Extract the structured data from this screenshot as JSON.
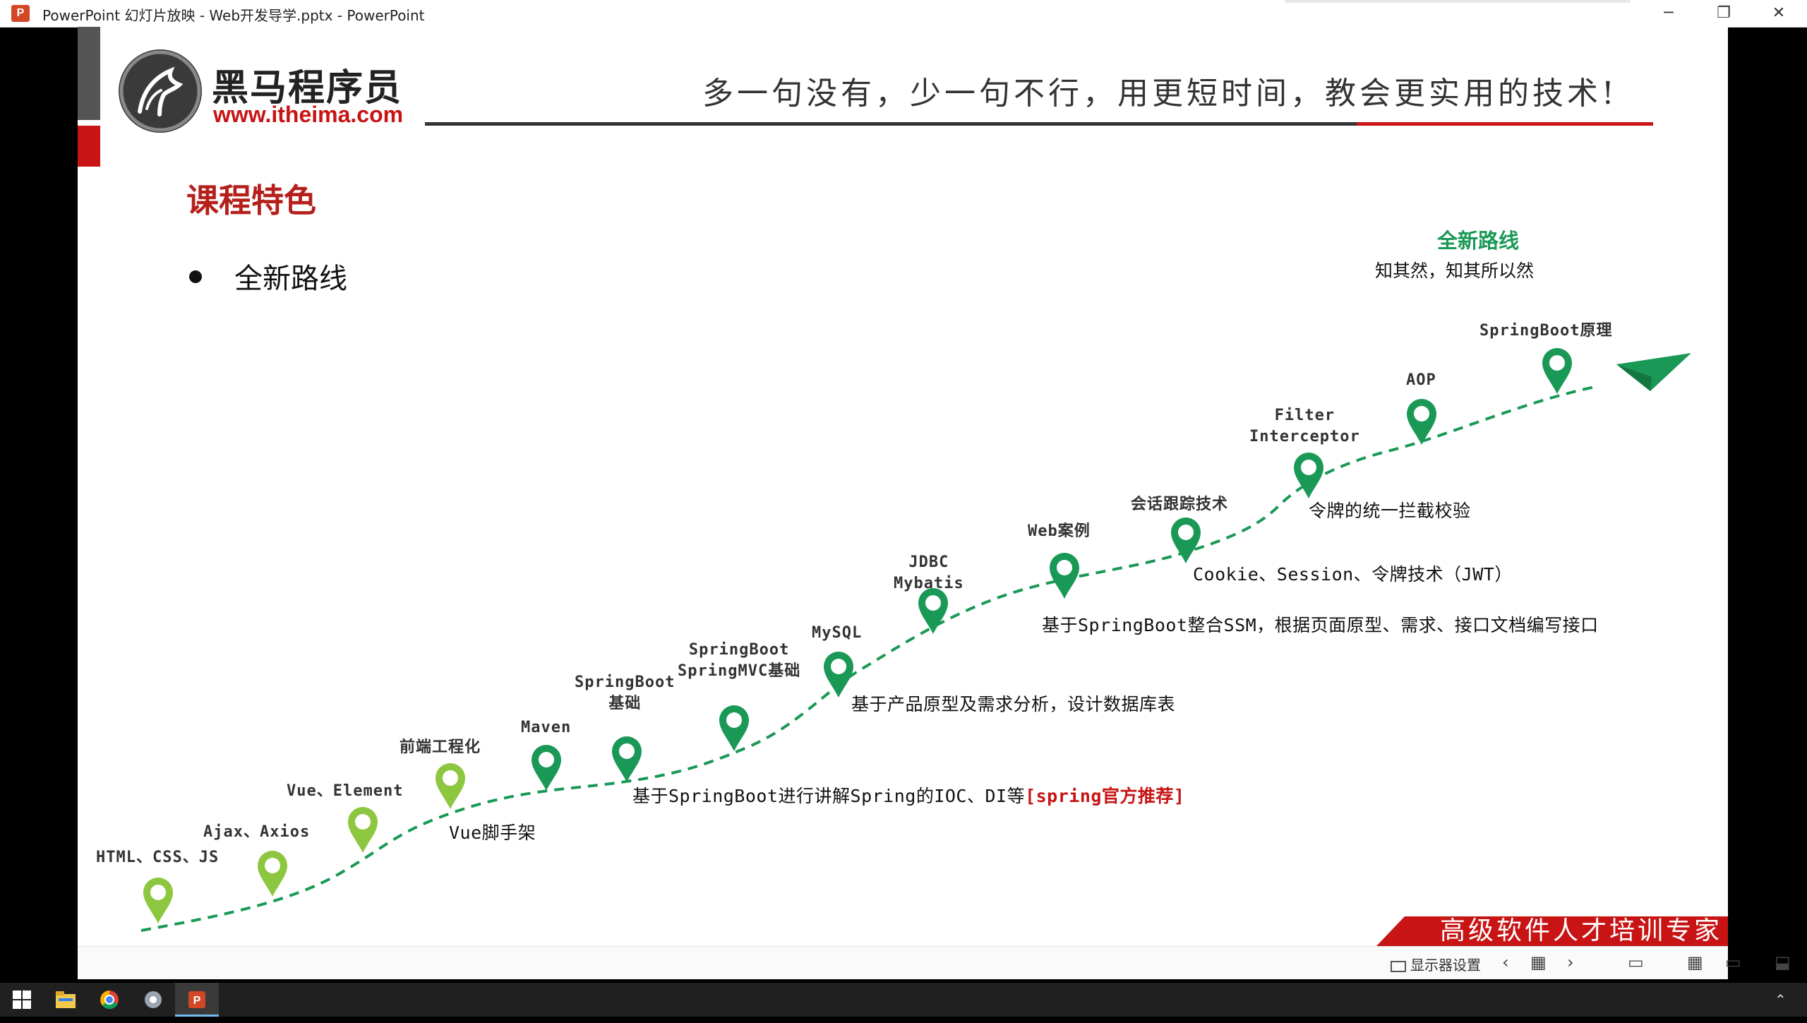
{
  "window": {
    "title": "PowerPoint 幻灯片放映  -  Web开发导学.pptx  -  PowerPoint",
    "app_icon": "P",
    "controls": {
      "minimize": "─",
      "restore": "❐",
      "close": "✕"
    }
  },
  "slide": {
    "logo": {
      "name": "黑马程序员",
      "url": "www.itheima.com"
    },
    "slogan": "多一句没有，少一句不行，用更短时间，教会更实用的技术!",
    "section_title": "课程特色",
    "bullet": "全新路线",
    "milestones": [
      {
        "label": "HTML、CSS、JS",
        "color": "#8dc63f"
      },
      {
        "label": "Ajax、Axios",
        "color": "#8dc63f"
      },
      {
        "label": "Vue、Element",
        "color": "#8dc63f"
      },
      {
        "label": "前端工程化",
        "color": "#8dc63f"
      },
      {
        "label": "Maven",
        "color": "#1a9956"
      },
      {
        "label": "SpringBoot\n基础",
        "color": "#1a9956"
      },
      {
        "label": "SpringBoot\nSpringMVC基础",
        "color": "#1a9956"
      },
      {
        "label": "MySQL",
        "color": "#1a9956"
      },
      {
        "label": "JDBC\nMybatis",
        "color": "#1a9956"
      },
      {
        "label": "Web案例",
        "color": "#1a9956"
      },
      {
        "label": "会话跟踪技术",
        "color": "#1a9956"
      },
      {
        "label": "Filter\nInterceptor",
        "color": "#1a9956"
      },
      {
        "label": "AOP",
        "color": "#1a9956"
      },
      {
        "label": "SpringBoot原理",
        "color": "#1a9956"
      }
    ],
    "descriptions": {
      "vue_scaffold": "Vue脚手架",
      "springboot_ioc": "基于SpringBoot进行讲解Spring的IOC、DI等",
      "springboot_ioc_highlight": "[spring官方推荐]",
      "db_design": "基于产品原型及需求分析，设计数据库表",
      "ssm_api": "基于SpringBoot整合SSM，根据页面原型、需求、接口文档编写接口",
      "session": "Cookie、Session、令牌技术（JWT）",
      "token_check": "令牌的统一拦截校验",
      "principle": "知其然，知其所以然"
    },
    "route_tag": "全新路线",
    "banner": "高级软件人才培训专家",
    "colors": {
      "brand_red": "#c81414",
      "route_green": "#1a9956",
      "light_green": "#8dc63f"
    }
  },
  "show_bar": {
    "display_settings": "显示器设置",
    "controls": [
      "‹",
      "▦",
      "›",
      "▭",
      "▦",
      "▭",
      "⬓"
    ]
  },
  "taskbar": {
    "items": [
      "start-icon",
      "file-explorer-icon",
      "chrome-icon",
      "app-icon",
      "powerpoint-icon"
    ]
  }
}
